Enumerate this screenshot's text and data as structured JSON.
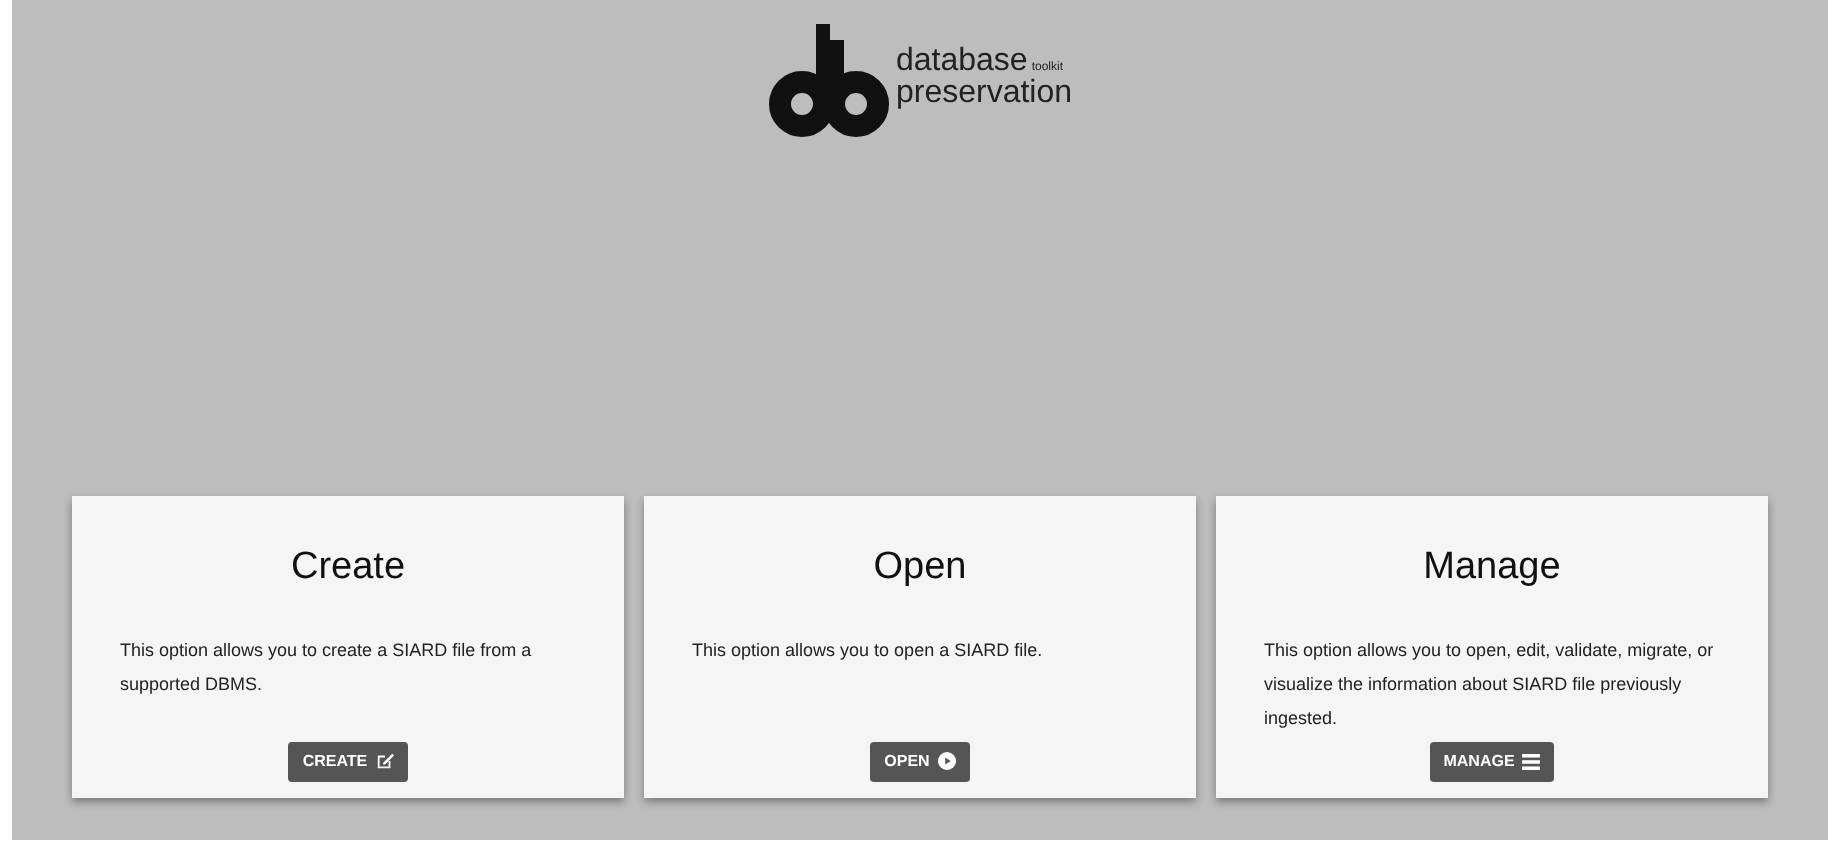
{
  "logo": {
    "line_1": "database",
    "tag": "toolkit",
    "line_2": "preservation"
  },
  "cards": [
    {
      "title": "Create",
      "text": "This option allows you to create a SIARD file from a supported DBMS.",
      "button": "CREATE",
      "kind": "create"
    },
    {
      "title": "Open",
      "text": "This option allows you to open a SIARD file.",
      "button": "OPEN",
      "kind": "open"
    },
    {
      "title": "Manage",
      "text": "This option allows you to open, edit, validate, migrate, or visualize the information about SIARD file previously ingested.",
      "button": "MANAGE",
      "kind": "manage"
    }
  ]
}
